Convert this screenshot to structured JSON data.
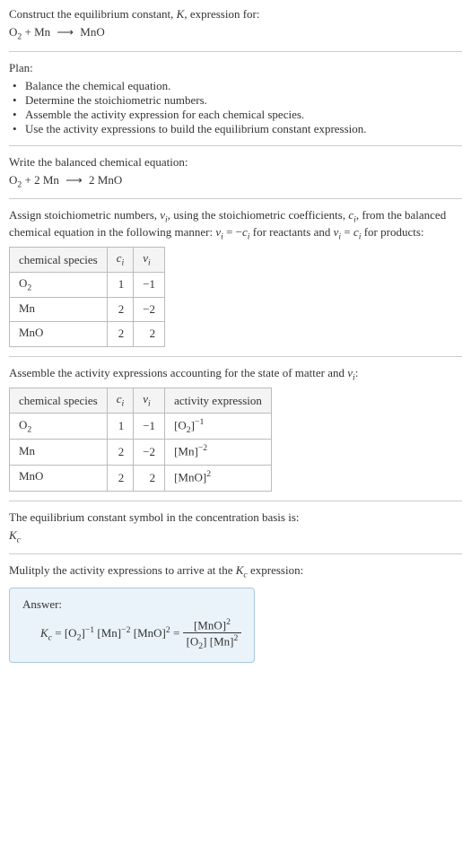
{
  "header": {
    "title_pre": "Construct the equilibrium constant, ",
    "title_K": "K",
    "title_post": ", expression for:",
    "equation_lhs_o2": "O",
    "equation_lhs_o2_sub": "2",
    "equation_plus": " + Mn ",
    "equation_arrow": "⟶",
    "equation_rhs": " MnO"
  },
  "plan": {
    "label": "Plan:",
    "items": [
      "Balance the chemical equation.",
      "Determine the stoichiometric numbers.",
      "Assemble the activity expression for each chemical species.",
      "Use the activity expressions to build the equilibrium constant expression."
    ]
  },
  "balanced": {
    "intro": "Write the balanced chemical equation:",
    "lhs_o2": "O",
    "lhs_o2_sub": "2",
    "plus": " + 2 Mn ",
    "arrow": "⟶",
    "rhs": " 2 MnO"
  },
  "assign": {
    "text_a": "Assign stoichiometric numbers, ",
    "nu": "ν",
    "i": "i",
    "text_b": ", using the stoichiometric coefficients, ",
    "c": "c",
    "text_c": ", from the balanced chemical equation in the following manner: ",
    "rel1a": " = −",
    "rel1b": " for reactants and ",
    "rel2a": " = ",
    "rel2b": " for products:",
    "table": {
      "h1": "chemical species",
      "h2": "c",
      "h3": "ν",
      "rows": [
        {
          "sp_a": "O",
          "sp_sub": "2",
          "c": "1",
          "v": "−1"
        },
        {
          "sp_a": "Mn",
          "sp_sub": "",
          "c": "2",
          "v": "−2"
        },
        {
          "sp_a": "MnO",
          "sp_sub": "",
          "c": "2",
          "v": "2"
        }
      ]
    }
  },
  "activity": {
    "intro_a": "Assemble the activity expressions accounting for the state of matter and ",
    "intro_b": ":",
    "table": {
      "h1": "chemical species",
      "h2": "c",
      "h3": "ν",
      "h4": "activity expression",
      "rows": [
        {
          "sp_a": "O",
          "sp_sub": "2",
          "c": "1",
          "v": "−1",
          "ae_a": "[O",
          "ae_sub": "2",
          "ae_b": "]",
          "ae_sup": "−1"
        },
        {
          "sp_a": "Mn",
          "sp_sub": "",
          "c": "2",
          "v": "−2",
          "ae_a": "[Mn",
          "ae_sub": "",
          "ae_b": "]",
          "ae_sup": "−2"
        },
        {
          "sp_a": "MnO",
          "sp_sub": "",
          "c": "2",
          "v": "2",
          "ae_a": "[MnO",
          "ae_sub": "",
          "ae_b": "]",
          "ae_sup": "2"
        }
      ]
    }
  },
  "symbol": {
    "line1": "The equilibrium constant symbol in the concentration basis is:",
    "K": "K",
    "c": "c"
  },
  "final": {
    "intro_a": "Mulitply the activity expressions to arrive at the ",
    "intro_b": " expression:",
    "answer_label": "Answer:",
    "Kc_K": "K",
    "Kc_c": "c",
    "eq": " = ",
    "t1_a": "[O",
    "t1_sub": "2",
    "t1_b": "]",
    "t1_sup": "−1",
    "t2_a": " [Mn]",
    "t2_sup": "−2",
    "t3_a": " [MnO]",
    "t3_sup": "2",
    "eq2": " = ",
    "frac_top": "[MnO]",
    "frac_top_sup": "2",
    "frac_bot_a": "[O",
    "frac_bot_sub": "2",
    "frac_bot_b": "] [Mn]",
    "frac_bot_sup": "2"
  }
}
